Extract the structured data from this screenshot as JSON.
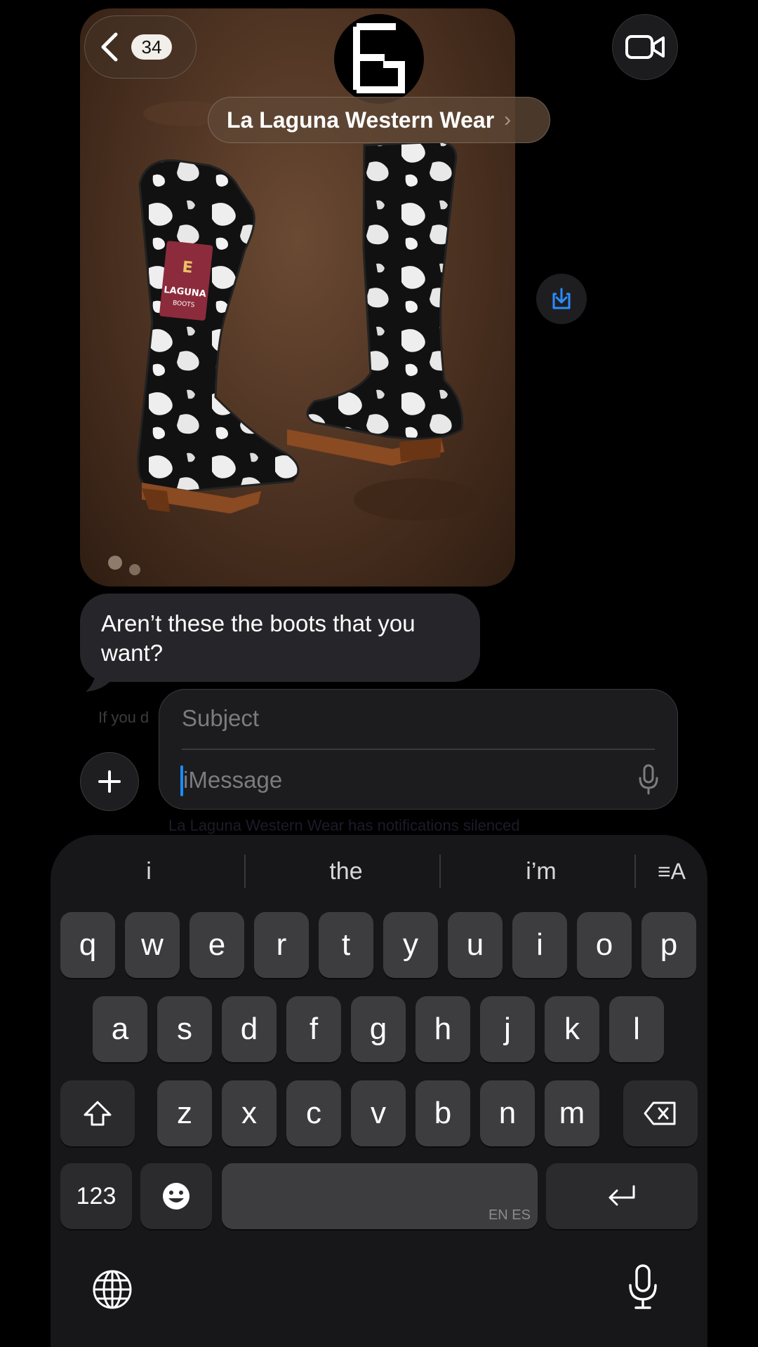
{
  "header": {
    "back_count": "34",
    "contact_name": "La Laguna Western Wear",
    "contact_chevron": "›",
    "avatar_monogram": "E G",
    "icons": [
      "back-chevron-icon",
      "video-call-icon",
      "save-download-icon"
    ]
  },
  "photo": {
    "tag_brand": "LAGUNA",
    "tag_sub": "BOOTS",
    "colors": {
      "leather": "#4a3020",
      "tag": "#8c2b3c"
    }
  },
  "message": {
    "text": "Aren’t these the boots that you want?",
    "faded_note": "If you d",
    "faded_focus_note": "La Laguna Western Wear has notifications silenced"
  },
  "compose": {
    "subject_placeholder": "Subject",
    "message_placeholder": "iMessage",
    "plus_label": "+"
  },
  "keyboard": {
    "suggestions": [
      "i",
      "the",
      "i’m"
    ],
    "format_icon": "≡A",
    "row1": [
      "q",
      "w",
      "e",
      "r",
      "t",
      "y",
      "u",
      "i",
      "o",
      "p"
    ],
    "row2": [
      "a",
      "s",
      "d",
      "f",
      "g",
      "h",
      "j",
      "k",
      "l"
    ],
    "row3": [
      "z",
      "x",
      "c",
      "v",
      "b",
      "n",
      "m"
    ],
    "numbers_label": "123",
    "space_hint": "EN ES",
    "accent_color": "#1a8cff"
  }
}
